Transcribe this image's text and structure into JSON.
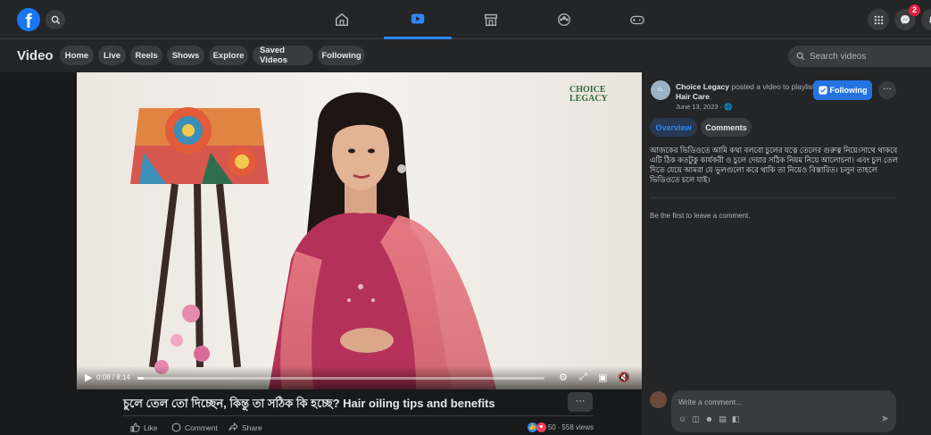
{
  "topbar": {
    "logo": "f",
    "search_icon": "search-icon",
    "nav_tabs": [
      {
        "icon": "home-icon",
        "active": false
      },
      {
        "icon": "video-icon",
        "active": true
      },
      {
        "icon": "marketplace-icon",
        "active": false
      },
      {
        "icon": "groups-icon",
        "active": false
      },
      {
        "icon": "gaming-icon",
        "active": false
      }
    ],
    "messenger_badge": "2"
  },
  "video_header": {
    "title": "Video",
    "pills": [
      "Home",
      "Live",
      "Reels",
      "Shows",
      "Explore",
      "Saved Videos",
      "Following"
    ],
    "search_placeholder": "Search videos"
  },
  "player": {
    "time": "0:08 / 8:14",
    "progress": 0.016,
    "watermark": "CHOICE LEGACY"
  },
  "video_info": {
    "title": "চুলে তেল তো দিচ্ছেন, কিন্তু তা সঠিক কি হচ্ছে? Hair oiling tips and benefits",
    "more": "···",
    "like": "Like",
    "comment": "Comment",
    "share": "Share",
    "reaction_count": "50",
    "views": "558 views"
  },
  "sidebar": {
    "page_name": "Choice Legacy",
    "posted_text": "posted a video to playlist",
    "playlist": "Hair Care",
    "date": "June 13, 2023 ·",
    "follow_label": "Following",
    "more": "···",
    "tabs": [
      "Overview",
      "Comments"
    ],
    "description": "আজকের ভিডিওতে আমি কথা বলবো চুলের যত্নে তেলের গুরুত্ব নিয়ে।সাথে থাকবে এটি ঠিক কতটুকু কার্যকরী ও চুলে দেয়ার সঠিক নিয়ম নিয়ে আলোচনা। এবং চুল তেল দিতে যেয়ে আমরা যে ভুলগুলো করে থাকি তা নিয়েও বিস্তারিত। চলুন তাহলে ভিডিওতে চলে যাই।",
    "first_comment": "Be the first to leave a comment.",
    "comment_placeholder": "Write a comment..."
  },
  "colors": {
    "accent": "#2d88ff",
    "button": "#2374e1",
    "background": "#18191a",
    "surface": "#242526"
  }
}
